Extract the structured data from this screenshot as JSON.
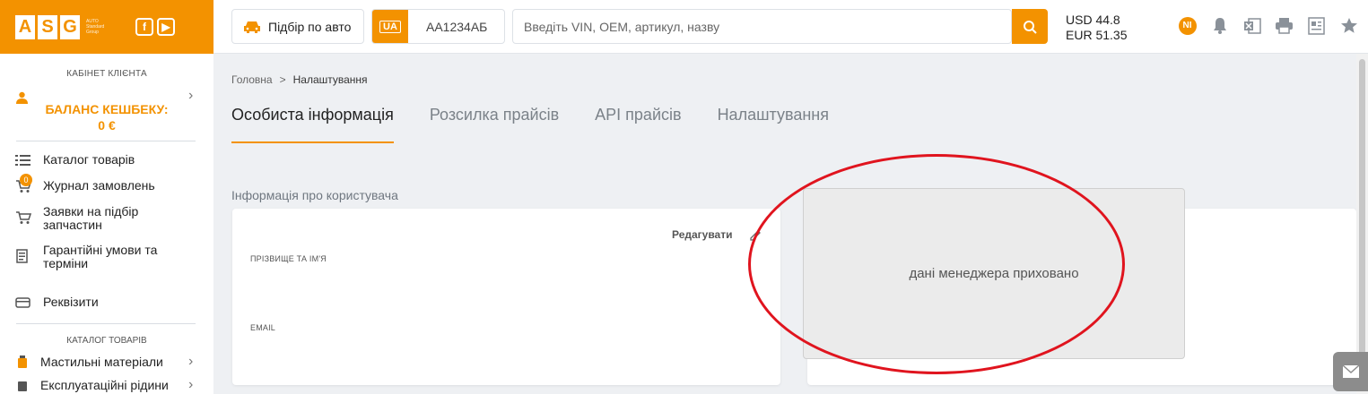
{
  "sidebar": {
    "logo_letters": [
      "A",
      "S",
      "G"
    ],
    "logo_sub": "AUTO Standard Group",
    "cabinet_caption": "КАБІНЕТ КЛІЄНТА",
    "cashback_label": "БАЛАНС КЕШБЕКУ:",
    "cashback_value": "0 €",
    "menu": [
      {
        "label": "Каталог товарів",
        "icon": "list-icon"
      },
      {
        "label": "Журнал замовлень",
        "icon": "cart-icon",
        "badge": "0"
      },
      {
        "label": "Заявки на підбір запчастин",
        "icon": "cart-search-icon"
      },
      {
        "label": "Гарантійні умови та терміни",
        "icon": "document-icon"
      },
      {
        "label": "Реквізити",
        "icon": "card-icon"
      }
    ],
    "catalog_caption": "КАТАЛОГ ТОВАРІВ",
    "catalog": [
      {
        "label": "Мастильні матеріали",
        "icon": "oil-icon"
      },
      {
        "label": "Експлуатаційні рідини",
        "icon": "fluid-icon"
      }
    ]
  },
  "header": {
    "car_pick_label": "Підбір по авто",
    "plate_country": "UA",
    "plate_number": "AA1234AБ",
    "search_placeholder": "Введіть VIN, OEM, артикул, назву",
    "rate_usd": "USD 44.8",
    "rate_eur": "EUR 51.35",
    "user_initials": "NI"
  },
  "breadcrumb": {
    "home": "Головна",
    "separator": ">",
    "current": "Налаштування"
  },
  "tabs": [
    "Особиста інформація",
    "Розсилка прайсів",
    "API прайсів",
    "Налаштування"
  ],
  "user_info": {
    "section_title": "Інформація про користувача",
    "edit_label": "Редагувати",
    "name_label": "ПРІЗВИЩЕ ТА ІМ'Я",
    "email_label": "EMAIL"
  },
  "manager": {
    "hidden_text": "дані менеджера приховано"
  },
  "colors": {
    "accent": "#f39200",
    "annotation": "#e0141e"
  }
}
